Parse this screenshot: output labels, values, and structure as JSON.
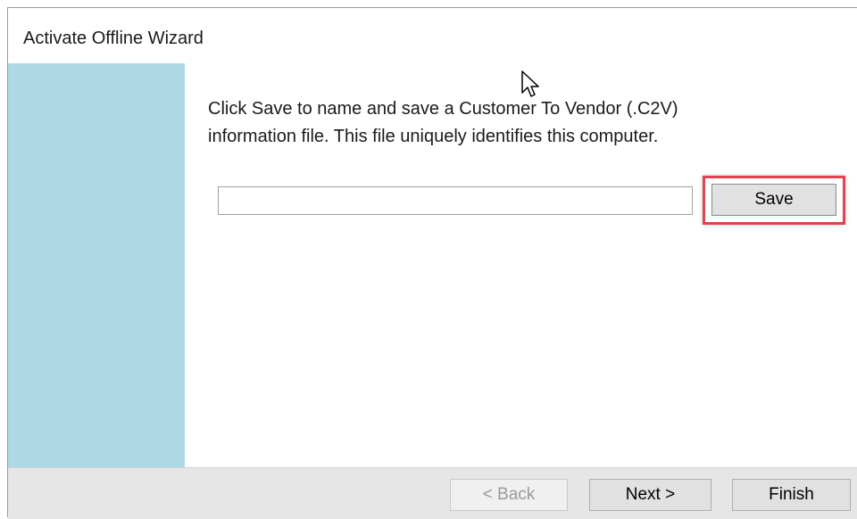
{
  "window": {
    "title": "Activate Offline Wizard",
    "side_panel_color": "#add8e6"
  },
  "content": {
    "instructions": "Click Save to name and save a Customer To Vendor (.C2V) information file.  This file uniquely identifies this computer.",
    "file_path_value": "",
    "save_label": "Save",
    "save_highlight_color": "#e0434d"
  },
  "footer": {
    "back_label": "< Back",
    "next_label": "Next >",
    "finish_label": "Finish"
  },
  "icons": {
    "cursor": "mouse-pointer-icon"
  }
}
